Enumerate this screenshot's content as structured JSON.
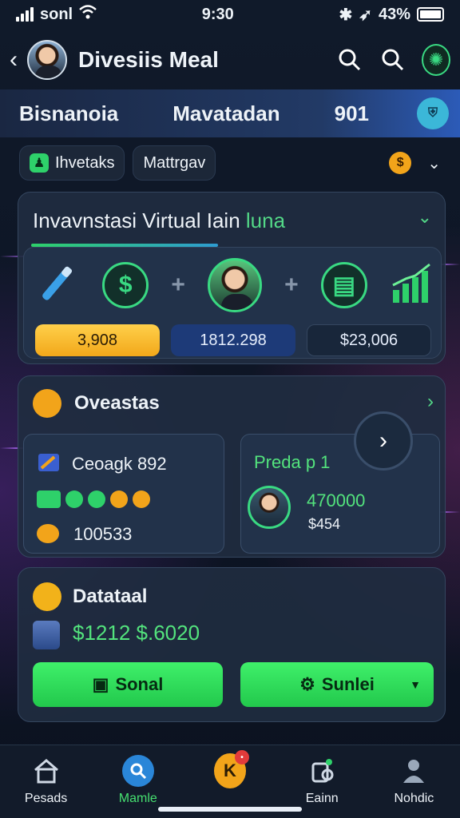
{
  "status": {
    "carrier": "sonl",
    "time": "9:30",
    "battery": "43%"
  },
  "header": {
    "title": "Divesiis Meal"
  },
  "tabs": [
    {
      "label": "Bisnanoia"
    },
    {
      "label": "Mavatadan"
    },
    {
      "label": "901"
    }
  ],
  "chips": [
    {
      "label": "Ihvetaks"
    },
    {
      "label": "Mattrgav"
    }
  ],
  "card_invest": {
    "title": "Invavnstasi Virtual Iain",
    "title_accent": "luna",
    "values": [
      "3,908",
      "1812.298",
      "$23,006"
    ]
  },
  "card_overview": {
    "title": "Oveastas",
    "left_title": "Ceoagk 892",
    "left_value": "100533",
    "right_title": "Preda p 1",
    "right_value": "470000",
    "right_sub": "$454"
  },
  "card_data": {
    "title": "Datataal",
    "amount": "$1212 $.6020",
    "btn_primary": "Sonal",
    "btn_secondary": "Sunlei"
  },
  "nav": [
    {
      "label": "Pesads",
      "icon": "home-icon"
    },
    {
      "label": "Mamle",
      "icon": "search-icon"
    },
    {
      "label": "",
      "icon": "coin-icon"
    },
    {
      "label": "Eainn",
      "icon": "cup-icon"
    },
    {
      "label": "Nohdic",
      "icon": "person-icon"
    }
  ],
  "colors": {
    "accent_green": "#39d982",
    "gold": "#f2a41a",
    "primary_blue": "#2a86d8"
  }
}
